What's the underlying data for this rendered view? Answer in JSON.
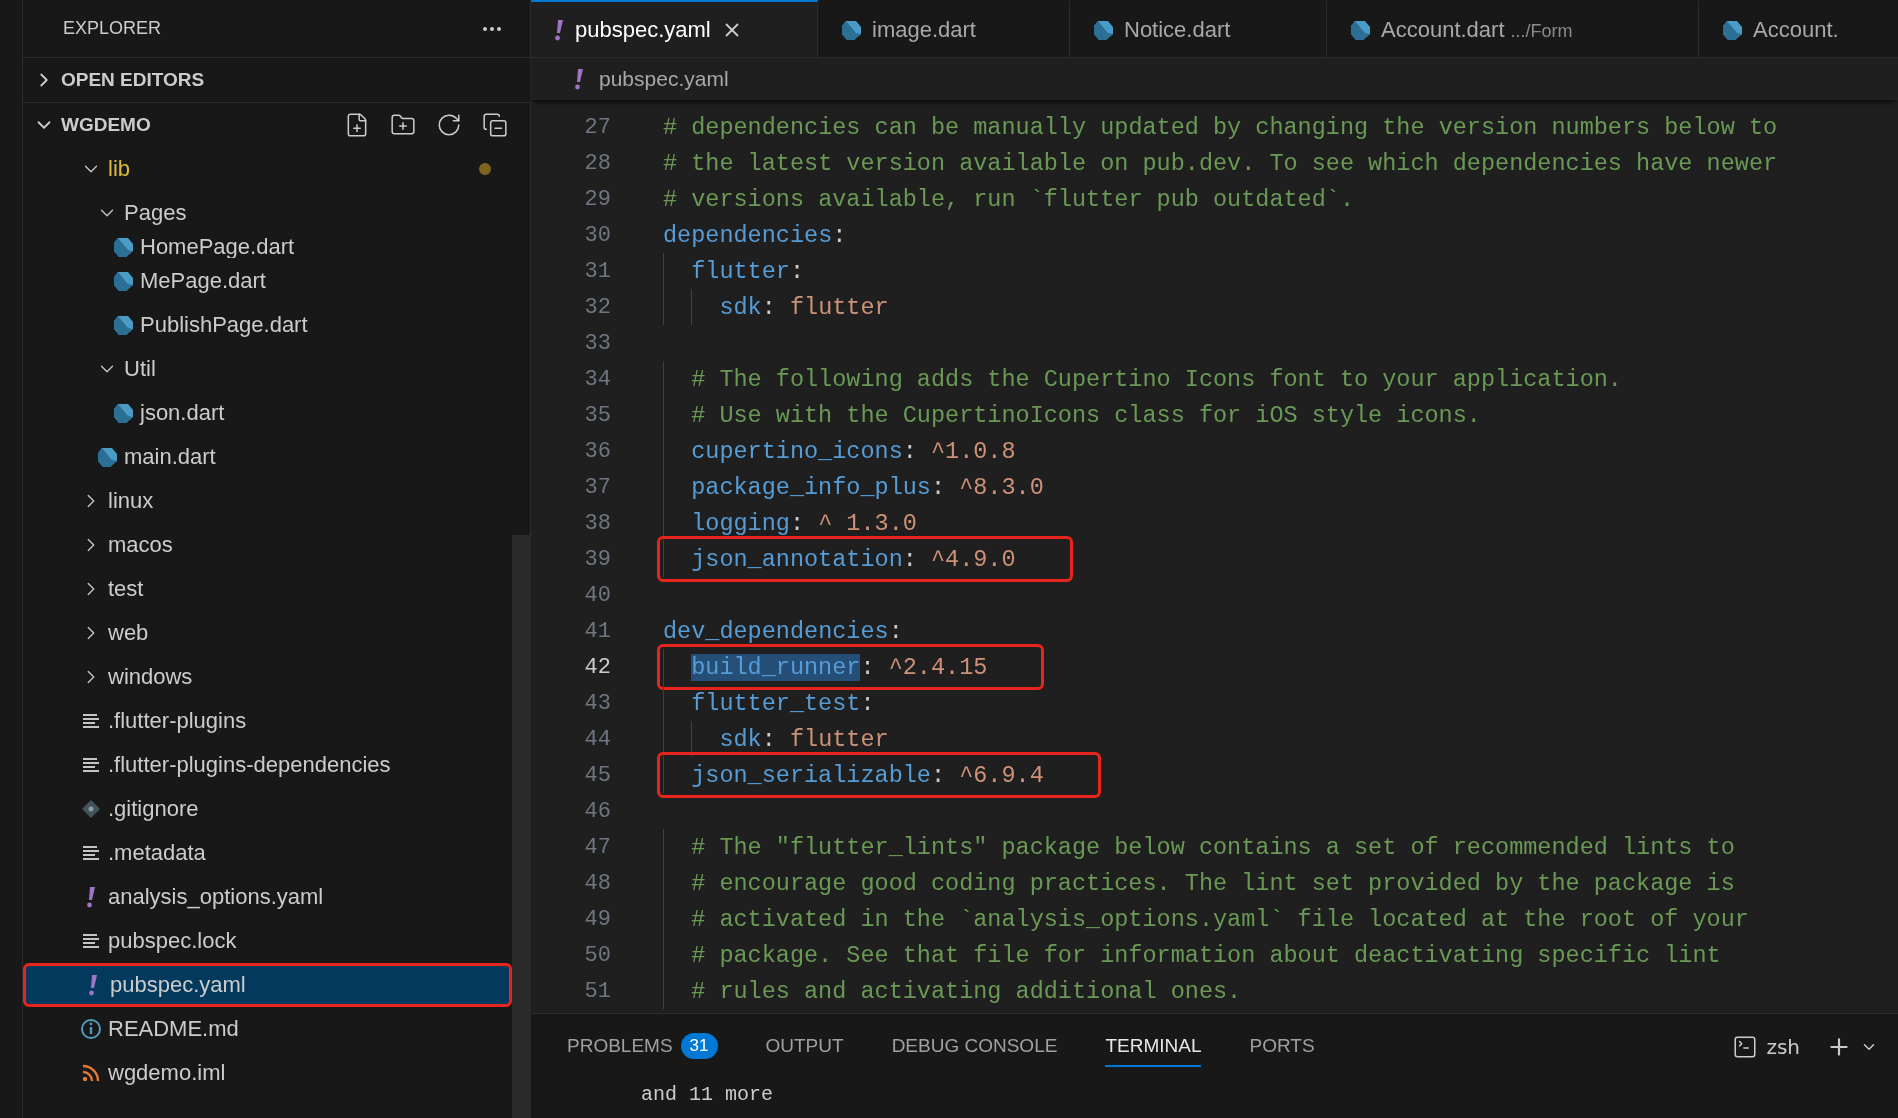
{
  "explorer": {
    "title": "EXPLORER",
    "open_editors": {
      "label": "OPEN EDITORS",
      "expanded": false
    },
    "project": {
      "label": "WGDEMO",
      "expanded": true,
      "tree": [
        {
          "kind": "folder",
          "label": "lib",
          "expanded": true,
          "modified": true,
          "children": [
            {
              "kind": "folder",
              "label": "Pages",
              "expanded": true,
              "children": [
                {
                  "kind": "dart",
                  "label": "HomePage.dart",
                  "selected": false,
                  "partial": true
                },
                {
                  "kind": "dart",
                  "label": "MePage.dart",
                  "selected": false
                },
                {
                  "kind": "dart",
                  "label": "PublishPage.dart",
                  "selected": false
                }
              ]
            },
            {
              "kind": "folder",
              "label": "Util",
              "expanded": true,
              "children": [
                {
                  "kind": "dart",
                  "label": "json.dart",
                  "selected": false
                }
              ]
            },
            {
              "kind": "dart",
              "label": "main.dart",
              "selected": false
            }
          ]
        },
        {
          "kind": "folder",
          "label": "linux",
          "expanded": false
        },
        {
          "kind": "folder",
          "label": "macos",
          "expanded": false
        },
        {
          "kind": "folder",
          "label": "test",
          "expanded": false
        },
        {
          "kind": "folder",
          "label": "web",
          "expanded": false
        },
        {
          "kind": "folder",
          "label": "windows",
          "expanded": false
        },
        {
          "kind": "lines",
          "label": ".flutter-plugins",
          "selected": false
        },
        {
          "kind": "lines",
          "label": ".flutter-plugins-dependencies",
          "selected": false
        },
        {
          "kind": "git",
          "label": ".gitignore",
          "selected": false
        },
        {
          "kind": "lines",
          "label": ".metadata",
          "selected": false
        },
        {
          "kind": "yaml",
          "label": "analysis_options.yaml",
          "selected": false
        },
        {
          "kind": "lines",
          "label": "pubspec.lock",
          "selected": false
        },
        {
          "kind": "yaml",
          "label": "pubspec.yaml",
          "selected": true,
          "annotated": true
        },
        {
          "kind": "info",
          "label": "README.md",
          "selected": false
        },
        {
          "kind": "feed",
          "label": "wgdemo.iml",
          "selected": false
        }
      ]
    }
  },
  "tabs": [
    {
      "kind": "yaml",
      "label": "pubspec.yaml",
      "selected": true
    },
    {
      "kind": "dart",
      "label": "image.dart",
      "selected": false
    },
    {
      "kind": "dart",
      "label": "Notice.dart",
      "selected": false
    },
    {
      "kind": "dart",
      "label": "Account.dart",
      "description": ".../Form",
      "selected": false
    },
    {
      "kind": "dart",
      "label": "Account.",
      "selected": false
    }
  ],
  "breadcrumb": {
    "kind": "yaml",
    "label": "pubspec.yaml"
  },
  "editor": {
    "lines": [
      {
        "number": "27",
        "current": false,
        "annotated": false,
        "tokens": [
          {
            "kind": "comment",
            "text": "# dependencies can be manually updated by changing the version numbers below to"
          }
        ]
      },
      {
        "number": "28",
        "current": false,
        "annotated": false,
        "tokens": [
          {
            "kind": "comment",
            "text": "# the latest version available on pub.dev. To see which dependencies have newer"
          }
        ]
      },
      {
        "number": "29",
        "current": false,
        "annotated": false,
        "tokens": [
          {
            "kind": "comment",
            "text": "# versions available, run `flutter pub outdated`."
          }
        ]
      },
      {
        "number": "30",
        "current": false,
        "annotated": false,
        "tokens": [
          {
            "kind": "key",
            "text": "dependencies"
          },
          {
            "kind": "punct",
            "text": ":"
          }
        ]
      },
      {
        "number": "31",
        "current": false,
        "annotated": false,
        "tokens": [
          {
            "kind": "key",
            "text": "  flutter"
          },
          {
            "kind": "punct",
            "text": ":"
          }
        ]
      },
      {
        "number": "32",
        "current": false,
        "annotated": false,
        "tokens": [
          {
            "kind": "key",
            "text": "    sdk"
          },
          {
            "kind": "punct",
            "text": ":"
          },
          {
            "kind": "value",
            "text": " flutter"
          }
        ]
      },
      {
        "number": "33",
        "current": false,
        "annotated": false
      },
      {
        "number": "34",
        "current": false,
        "annotated": false,
        "tokens": [
          {
            "kind": "comment",
            "text": "  # The following adds the Cupertino Icons font to your application."
          }
        ]
      },
      {
        "number": "35",
        "current": false,
        "annotated": false,
        "tokens": [
          {
            "kind": "comment",
            "text": "  # Use with the CupertinoIcons class for iOS style icons."
          }
        ]
      },
      {
        "number": "36",
        "current": false,
        "annotated": false,
        "tokens": [
          {
            "kind": "key",
            "text": "  cupertino_icons"
          },
          {
            "kind": "punct",
            "text": ":"
          },
          {
            "kind": "value",
            "text": " ^1.0.8"
          }
        ]
      },
      {
        "number": "37",
        "current": false,
        "annotated": false,
        "tokens": [
          {
            "kind": "key",
            "text": "  package_info_plus"
          },
          {
            "kind": "punct",
            "text": ":"
          },
          {
            "kind": "value",
            "text": " ^8.3.0"
          }
        ]
      },
      {
        "number": "38",
        "current": false,
        "annotated": false,
        "tokens": [
          {
            "kind": "key",
            "text": "  logging"
          },
          {
            "kind": "punct",
            "text": ":"
          },
          {
            "kind": "value",
            "text": " ^ 1.3.0"
          }
        ]
      },
      {
        "number": "39",
        "current": false,
        "annotated": true,
        "tokens": [
          {
            "kind": "key",
            "text": "  json_annotation"
          },
          {
            "kind": "punct",
            "text": ":"
          },
          {
            "kind": "value",
            "text": " ^4.9.0"
          }
        ]
      },
      {
        "number": "40",
        "current": false,
        "annotated": false
      },
      {
        "number": "41",
        "current": false,
        "annotated": false,
        "tokens": [
          {
            "kind": "key",
            "text": "dev_dependencies"
          },
          {
            "kind": "punct",
            "text": ":"
          }
        ]
      },
      {
        "number": "42",
        "current": true,
        "annotated": true,
        "tokens": [
          {
            "kind": "key",
            "text": "  build_runner",
            "selected": true
          },
          {
            "kind": "punct",
            "text": ":"
          },
          {
            "kind": "value",
            "text": " ^2.4.15"
          }
        ]
      },
      {
        "number": "43",
        "current": false,
        "annotated": false,
        "tokens": [
          {
            "kind": "key",
            "text": "  flutter_test"
          },
          {
            "kind": "punct",
            "text": ":"
          }
        ]
      },
      {
        "number": "44",
        "current": false,
        "annotated": false,
        "tokens": [
          {
            "kind": "key",
            "text": "    sdk"
          },
          {
            "kind": "punct",
            "text": ":"
          },
          {
            "kind": "value",
            "text": " flutter"
          }
        ]
      },
      {
        "number": "45",
        "current": false,
        "annotated": true,
        "tokens": [
          {
            "kind": "key",
            "text": "  json_serializable"
          },
          {
            "kind": "punct",
            "text": ":"
          },
          {
            "kind": "value",
            "text": " ^6.9.4"
          }
        ]
      },
      {
        "number": "46",
        "current": false,
        "annotated": false
      },
      {
        "number": "47",
        "current": false,
        "annotated": false,
        "tokens": [
          {
            "kind": "comment",
            "text": "  # The \"flutter_lints\" package below contains a set of recommended lints to"
          }
        ]
      },
      {
        "number": "48",
        "current": false,
        "annotated": false,
        "tokens": [
          {
            "kind": "comment",
            "text": "  # encourage good coding practices. The lint set provided by the package is"
          }
        ]
      },
      {
        "number": "49",
        "current": false,
        "annotated": false,
        "tokens": [
          {
            "kind": "comment",
            "text": "  # activated in the `analysis_options.yaml` file located at the root of your"
          }
        ]
      },
      {
        "number": "50",
        "current": false,
        "annotated": false,
        "tokens": [
          {
            "kind": "comment",
            "text": "  # package. See that file for information about deactivating specific lint"
          }
        ]
      },
      {
        "number": "51",
        "current": false,
        "annotated": false,
        "tokens": [
          {
            "kind": "comment",
            "text": "  # rules and activating additional ones."
          }
        ]
      }
    ]
  },
  "panel": {
    "tabs": [
      {
        "label": "PROBLEMS",
        "badge": "31",
        "selected": false
      },
      {
        "label": "OUTPUT",
        "selected": false
      },
      {
        "label": "DEBUG CONSOLE",
        "selected": false
      },
      {
        "label": "TERMINAL",
        "selected": true
      },
      {
        "label": "PORTS",
        "selected": false
      }
    ],
    "shell": "zsh",
    "terminal_lines": [
      "and 11 more"
    ]
  }
}
